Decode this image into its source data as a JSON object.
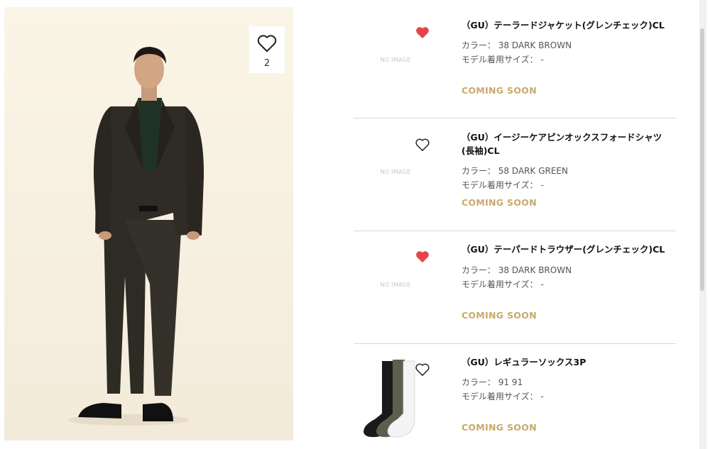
{
  "hero": {
    "favorite_count": "2"
  },
  "items": [
    {
      "title": "（GU）テーラードジャケット(グレンチェック)CL",
      "color_label": "カラー：",
      "color_value": "38 DARK BROWN",
      "size_label": "モデル着用サイズ：",
      "size_value": "-",
      "status": "COMING SOON",
      "image_text": "NO IMAGE",
      "favorited": true
    },
    {
      "title": "（GU）イージーケアピンオックスフォードシャツ(長袖)CL",
      "color_label": "カラー：",
      "color_value": "58 DARK GREEN",
      "size_label": "モデル着用サイズ：",
      "size_value": "-",
      "status": "COMING SOON",
      "image_text": "NO IMAGE",
      "favorited": false
    },
    {
      "title": "（GU）テーパードトラウザー(グレンチェック)CL",
      "color_label": "カラー：",
      "color_value": "38 DARK BROWN",
      "size_label": "モデル着用サイズ：",
      "size_value": "-",
      "status": "COMING SOON",
      "image_text": "NO IMAGE",
      "favorited": true
    },
    {
      "title": "（GU）レギュラーソックス3P",
      "color_label": "カラー：",
      "color_value": "91 91",
      "size_label": "モデル着用サイズ：",
      "size_value": "-",
      "status": "COMING SOON",
      "favorited": false
    }
  ],
  "colors": {
    "heart_filled": "#e8434b",
    "coming_soon": "#c9a96b"
  }
}
